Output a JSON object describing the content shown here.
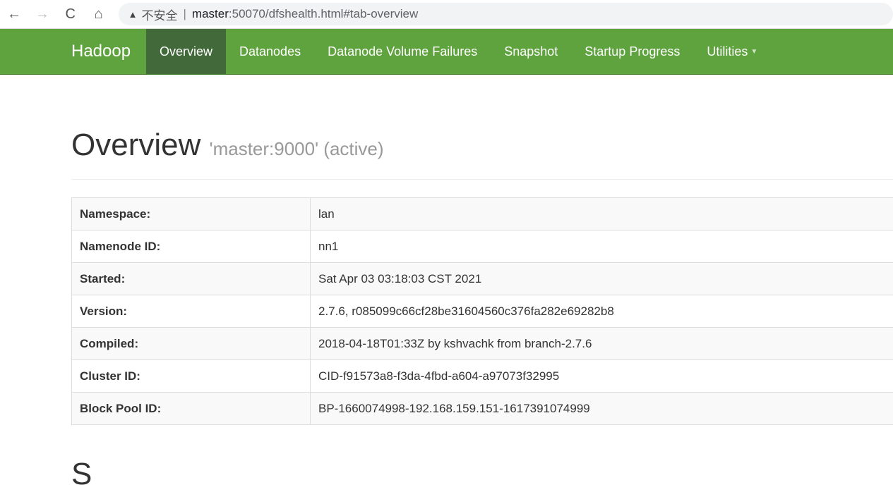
{
  "browser": {
    "back": "←",
    "forward": "→",
    "reload": "C",
    "home": "⌂",
    "warning_icon": "▲",
    "insecure": "不安全",
    "separator": "|",
    "url_host": "master",
    "url_rest": ":50070/dfshealth.html#tab-overview"
  },
  "nav": {
    "brand": "Hadoop",
    "items": [
      {
        "label": "Overview",
        "active": true
      },
      {
        "label": "Datanodes"
      },
      {
        "label": "Datanode Volume Failures"
      },
      {
        "label": "Snapshot"
      },
      {
        "label": "Startup Progress"
      },
      {
        "label": "Utilities"
      }
    ],
    "color": "#5fa33e",
    "active_color": "#42693a"
  },
  "overview": {
    "title": "Overview",
    "subtitle": "'master:9000' (active)",
    "rows": [
      {
        "key": "Namespace:",
        "value": "lan"
      },
      {
        "key": "Namenode ID:",
        "value": "nn1"
      },
      {
        "key": "Started:",
        "value": "Sat Apr 03 03:18:03 CST 2021"
      },
      {
        "key": "Version:",
        "value": "2.7.6, r085099c66cf28be31604560c376fa282e69282b8"
      },
      {
        "key": "Compiled:",
        "value": "2018-04-18T01:33Z by kshvachk from branch-2.7.6"
      },
      {
        "key": "Cluster ID:",
        "value": "CID-f91573a8-f3da-4fbd-a604-a97073f32995"
      },
      {
        "key": "Block Pool ID:",
        "value": "BP-1660074998-192.168.159.151-1617391074999"
      }
    ]
  },
  "next_section": {
    "title": "S"
  }
}
